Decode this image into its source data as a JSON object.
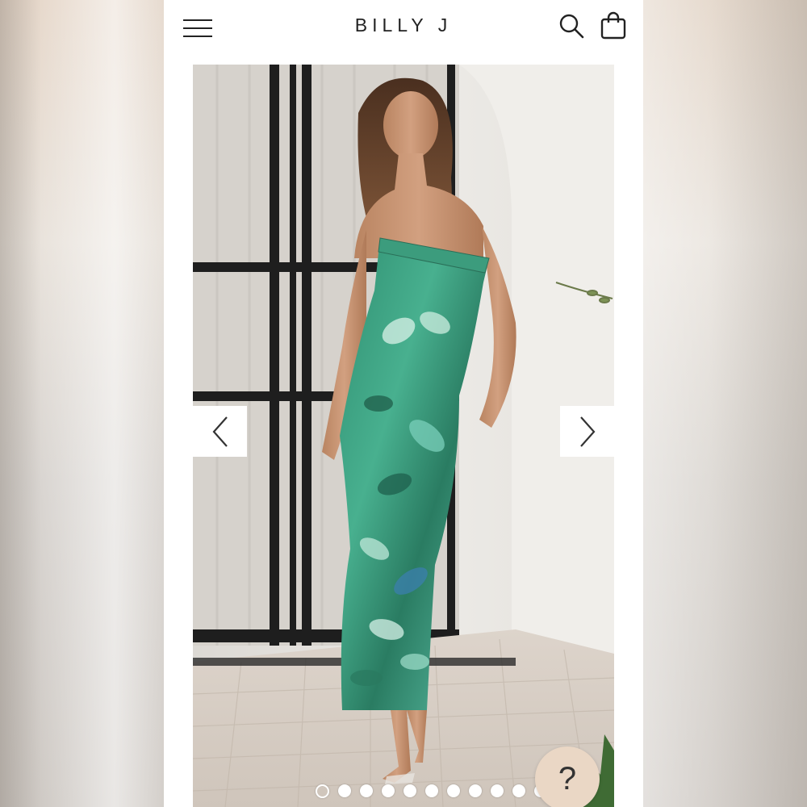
{
  "header": {
    "brand": "BILLY J",
    "menu_icon": "hamburger-menu-icon",
    "search_icon": "search-icon",
    "bag_icon": "shopping-bag-icon"
  },
  "gallery": {
    "image": "model-in-green-floral-strapless-maxi-dress",
    "prev_icon": "chevron-left-icon",
    "next_icon": "chevron-right-icon",
    "slide_count": 11,
    "active_slide": 1
  },
  "help": {
    "label": "?"
  },
  "colors": {
    "dress_primary": "#2e9a78",
    "dress_secondary": "#6cc7b0",
    "help_button": "#ead7c5"
  }
}
